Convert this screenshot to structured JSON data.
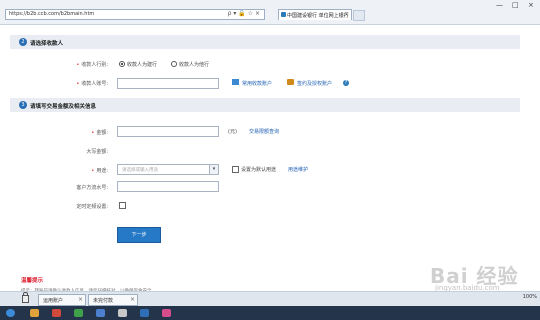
{
  "browser": {
    "url": "https://b2b.ccb.com/b2bmain.htm",
    "tab_title": "中国建设银行 单位网上银行",
    "address_tools": "ρ ▾ 🔒 ☆ ×",
    "window_controls": [
      "—",
      "□",
      "×"
    ]
  },
  "section1": {
    "number": "2",
    "title": "请选择收款人",
    "bank_label": "收款人行别:",
    "radio_same": "收款人为建行",
    "radio_other": "收款人为他行",
    "radio_selected": "same",
    "account_label": "收款人账号:",
    "account_value": "",
    "common_link": "常用收款账户",
    "internal_link": "签约及授权账户"
  },
  "section2": {
    "number": "3",
    "title": "请填写交易金额及相关信息",
    "amount_label": "金额:",
    "amount_value": "",
    "unit": "(元)",
    "fee_link": "交易限额查询",
    "uppercase_label": "大写金额:",
    "uppercase_value": "",
    "usage_label": "用途:",
    "usage_placeholder": "请选择或输入用途",
    "default_usage_label": "设置为默认用途",
    "usage_link": "用途维护",
    "serial_label": "客户方流水号:",
    "serial_value": "",
    "schedule_label": "定时定频设置:"
  },
  "next_button": "下一步",
  "warm_tip": "温馨提示",
  "faint_tip": "提示：转账前请确认收款人信息，请您仔细核对，以确保资金安全。",
  "bottom_tabs": [
    "运用账户",
    "未完付款"
  ],
  "zoom_label": "100%",
  "watermark": "Bai 经验",
  "watermark_url": "jingyan.baidu.com",
  "colors": {
    "accent": "#2579c7",
    "section_bg": "#e9edf3",
    "warning": "#d23333",
    "link": "#1f5fb3"
  }
}
